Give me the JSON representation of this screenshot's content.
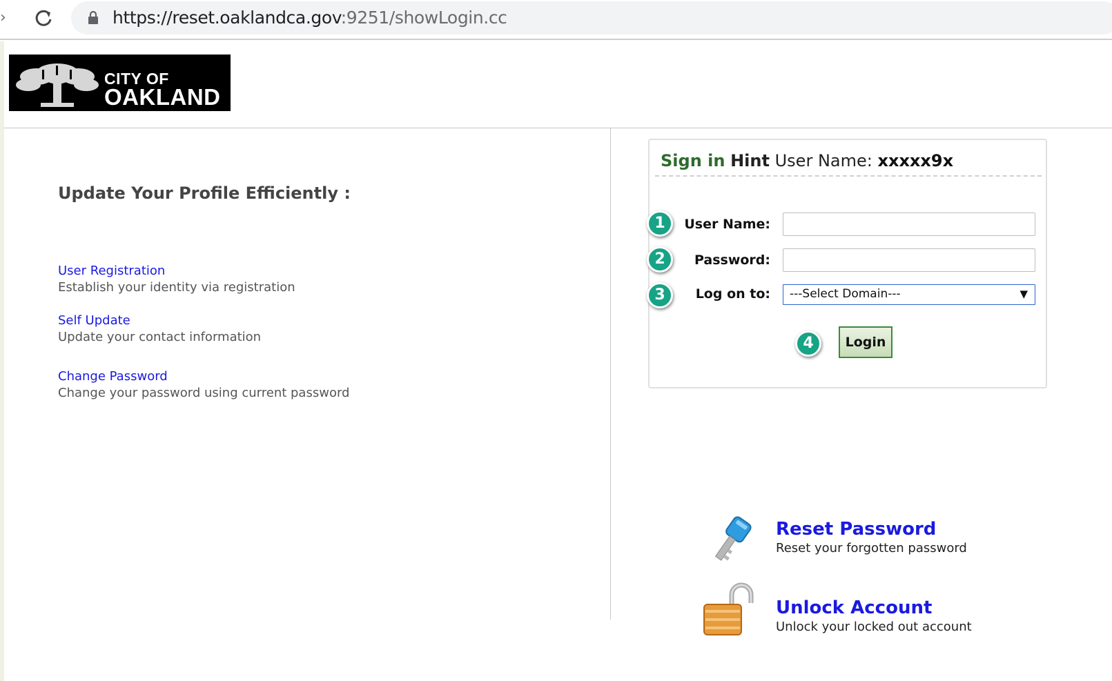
{
  "browser": {
    "url_host": "https://reset.oaklandca.gov",
    "url_path": ":9251/showLogin.cc"
  },
  "logo": {
    "line1": "CITY OF",
    "line2": "OAKLAND"
  },
  "left": {
    "heading": "Update Your Profile Efficiently :",
    "features": [
      {
        "link": "User Registration",
        "desc": "Establish your identity via registration"
      },
      {
        "link": "Self Update",
        "desc": "Update your contact information"
      },
      {
        "link": "Change Password",
        "desc": "Change your password using current password"
      }
    ]
  },
  "login": {
    "title_signin": "Sign in",
    "title_hint": "Hint",
    "title_label": "User Name:",
    "title_value": "xxxxx9x",
    "steps": [
      "1",
      "2",
      "3",
      "4"
    ],
    "username_label": "User Name:",
    "username_value": "",
    "password_label": "Password:",
    "password_value": "",
    "domain_label": "Log on to:",
    "domain_selected": "---Select Domain---",
    "login_button": "Login"
  },
  "actions": [
    {
      "title": "Reset Password",
      "desc": "Reset your forgotten password",
      "icon": "key-icon"
    },
    {
      "title": "Unlock Account",
      "desc": "Unlock your locked out account",
      "icon": "padlock-icon"
    }
  ],
  "colors": {
    "link": "#1a1ae0",
    "signin_green": "#2e6b2e",
    "badge_teal": "#17a386",
    "logo_bg": "#000000"
  }
}
